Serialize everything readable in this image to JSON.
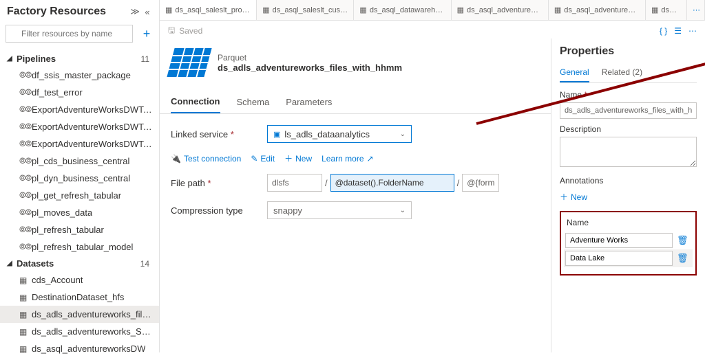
{
  "sidebar": {
    "title": "Factory Resources",
    "filter_placeholder": "Filter resources by name",
    "sections": [
      {
        "label": "Pipelines",
        "count": "11",
        "items": [
          {
            "label": "df_ssis_master_package",
            "icon": "pipeline"
          },
          {
            "label": "df_test_error",
            "icon": "pipeline"
          },
          {
            "label": "ExportAdventureWorksDWToParque...",
            "icon": "pipeline"
          },
          {
            "label": "ExportAdventureWorksDWToParque...",
            "icon": "pipeline"
          },
          {
            "label": "ExportAdventureWorksDWToParque...",
            "icon": "pipeline"
          },
          {
            "label": "pl_cds_business_central",
            "icon": "pipeline"
          },
          {
            "label": "pl_dyn_business_central",
            "icon": "pipeline"
          },
          {
            "label": "pl_get_refresh_tabular",
            "icon": "pipeline"
          },
          {
            "label": "pl_moves_data",
            "icon": "pipeline"
          },
          {
            "label": "pl_refresh_tabular",
            "icon": "pipeline"
          },
          {
            "label": "pl_refresh_tabular_model",
            "icon": "pipeline"
          }
        ]
      },
      {
        "label": "Datasets",
        "count": "14",
        "items": [
          {
            "label": "cds_Account",
            "icon": "table"
          },
          {
            "label": "DestinationDataset_hfs",
            "icon": "table"
          },
          {
            "label": "ds_adls_adventureworks_files_with_h...",
            "icon": "table",
            "selected": true
          },
          {
            "label": "ds_adls_adventureworks_Sales_with_...",
            "icon": "table"
          },
          {
            "label": "ds_asql_adventureworksDW",
            "icon": "table"
          }
        ]
      }
    ]
  },
  "tabs": [
    {
      "label": "ds_asql_saleslt_product",
      "active": true
    },
    {
      "label": "ds_asql_saleslt_custo..."
    },
    {
      "label": "ds_asql_datawarehouse"
    },
    {
      "label": "ds_asql_adventurewo..."
    },
    {
      "label": "ds_asql_adventurewo..."
    },
    {
      "label": "ds_adls"
    }
  ],
  "saved_label": "Saved",
  "dataset": {
    "type": "Parquet",
    "name": "ds_adls_adventureworks_files_with_hhmm"
  },
  "subtabs": {
    "connection": "Connection",
    "schema": "Schema",
    "parameters": "Parameters"
  },
  "form": {
    "linked_service_label": "Linked service",
    "linked_service_value": "ls_adls_dataanalytics",
    "test_connection": "Test connection",
    "edit": "Edit",
    "new": "New",
    "learn_more": "Learn more",
    "file_path_label": "File path",
    "container": "dlsfs",
    "folder_expr": "@dataset().FolderName",
    "file_expr": "@{forma",
    "compression_label": "Compression type",
    "compression_value": "snappy"
  },
  "properties": {
    "title": "Properties",
    "tab_general": "General",
    "tab_related": "Related (2)",
    "name_label": "Name",
    "name_value": "ds_adls_adventureworks_files_with_hhmm",
    "description_label": "Description",
    "annotations_label": "Annotations",
    "new_label": "New",
    "name_header": "Name",
    "annotations": [
      {
        "value": "Adventure Works"
      },
      {
        "value": "Data Lake"
      }
    ]
  }
}
